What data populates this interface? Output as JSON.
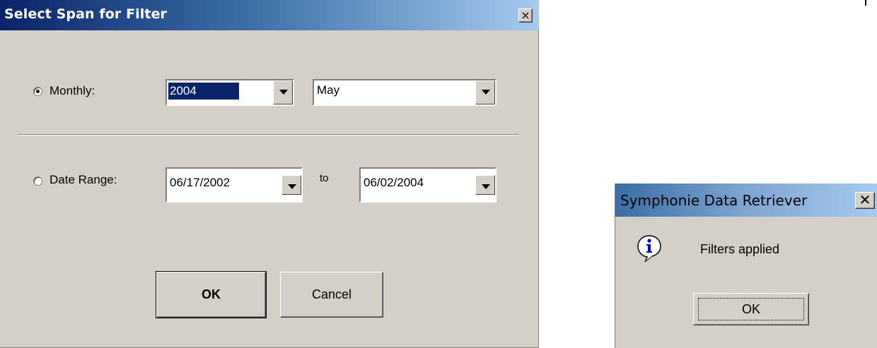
{
  "dialog": {
    "title": "Select Span for Filter",
    "close_label": "×",
    "monthly": {
      "label": "Monthly:",
      "selected": true,
      "year_value": "2004",
      "month_value": "May"
    },
    "date_range": {
      "label": "Date Range:",
      "selected": false,
      "from_value": "06/17/2002",
      "to_label": "to",
      "to_value": "06/02/2004"
    },
    "ok_label": "OK",
    "cancel_label": "Cancel"
  },
  "message_box": {
    "title": "Symphonie Data Retriever",
    "close_label": "✕",
    "icon": "info-icon",
    "message": "Filters applied",
    "ok_label": "OK"
  },
  "colors": {
    "face": "#d4d0c8",
    "title_active": "#0a246a",
    "selection": "#0a246a"
  }
}
